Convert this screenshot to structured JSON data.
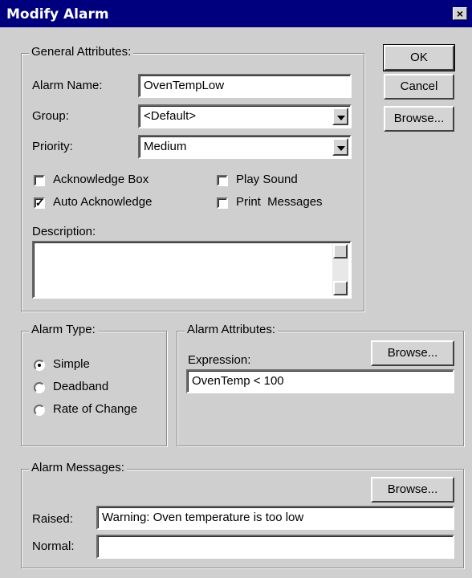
{
  "window": {
    "title": "Modify Alarm",
    "close_glyph": "×"
  },
  "buttons": {
    "ok": "OK",
    "cancel": "Cancel",
    "browse": "Browse..."
  },
  "general": {
    "legend": "General Attributes:",
    "alarm_name_label": "Alarm Name:",
    "alarm_name_value": "OvenTempLow",
    "group_label": "Group:",
    "group_value": "<Default>",
    "priority_label": "Priority:",
    "priority_value": "Medium",
    "checkboxes": {
      "acknowledge_box": {
        "label": "Acknowledge Box",
        "checked": false
      },
      "auto_acknowledge": {
        "label": "Auto Acknowledge",
        "checked": true
      },
      "play_sound": {
        "label": "Play Sound",
        "checked": false
      },
      "print_messages": {
        "label": "Print  Messages",
        "checked": false
      }
    },
    "description_label": "Description:",
    "description_value": ""
  },
  "alarm_type": {
    "legend": "Alarm Type:",
    "options": [
      "Simple",
      "Deadband",
      "Rate of Change"
    ],
    "selected": "Simple"
  },
  "alarm_attributes": {
    "legend": "Alarm Attributes:",
    "expression_label": "Expression:",
    "expression_value": "OvenTemp < 100",
    "browse": "Browse..."
  },
  "alarm_messages": {
    "legend": "Alarm Messages:",
    "browse": "Browse...",
    "raised_label": "Raised:",
    "raised_value": "Warning: Oven temperature is too low",
    "normal_label": "Normal:",
    "normal_value": ""
  },
  "icons": {
    "checkmark": "✓",
    "dropdown": "chevron-down-icon",
    "scroll_up": "arrow-up-icon",
    "scroll_down": "arrow-down-icon"
  },
  "colors": {
    "titlebar": "#00007f",
    "face": "#cfcfcf"
  }
}
